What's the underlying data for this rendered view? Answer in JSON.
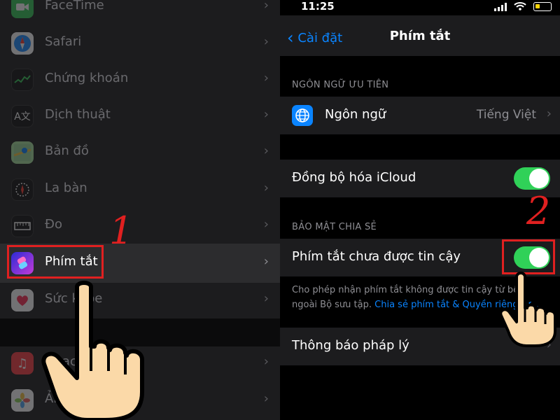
{
  "left_settings": {
    "items": [
      {
        "label": "FaceTime",
        "icon": "facetime-icon",
        "color": "#34c759"
      },
      {
        "label": "Safari",
        "icon": "safari-icon",
        "color": "#0a84ff"
      },
      {
        "label": "Chứng khoán",
        "icon": "stocks-icon",
        "color": "#1c1c1e"
      },
      {
        "label": "Dịch thuật",
        "icon": "translate-icon",
        "color": "#1c1c1e"
      },
      {
        "label": "Bản đồ",
        "icon": "maps-icon",
        "color": "#34c759"
      },
      {
        "label": "La bàn",
        "icon": "compass-icon",
        "color": "#1c1c1e"
      },
      {
        "label": "Đo",
        "icon": "measure-icon",
        "color": "#1c1c1e"
      },
      {
        "label": "Phím tắt",
        "icon": "shortcuts-icon",
        "color": "#5e5ce6"
      },
      {
        "label": "Sức khỏe",
        "icon": "health-icon",
        "color": "#ffffff"
      },
      {
        "label": "Nhạc",
        "icon": "music-icon",
        "color": "#fc3c44"
      },
      {
        "label": "Ảnh",
        "icon": "photos-icon",
        "color": "#ffffff"
      }
    ]
  },
  "annotations": {
    "step1": "1",
    "step2": "2"
  },
  "status_bar": {
    "time": "11:25"
  },
  "navbar": {
    "back_label": "Cài đặt",
    "title": "Phím tắt"
  },
  "preferred_language": {
    "header": "NGÔN NGỮ ƯU TIÊN",
    "label": "Ngôn ngữ",
    "value": "Tiếng Việt"
  },
  "icloud_sync": {
    "label": "Đồng bộ hóa iCloud",
    "enabled": true
  },
  "sharing_security": {
    "header": "BẢO MẬT CHIA SẺ",
    "untrusted_label": "Phím tắt chưa được tin cậy",
    "enabled": true,
    "footer_line1": "Cho phép nhận phím tắt không được tin cậy từ bên",
    "footer_line2_prefix": "ngoài Bộ sưu tập.",
    "footer_link": "Chia sẻ phím tắt & Quyền riêng tư..."
  },
  "legal": {
    "label": "Thông báo pháp lý"
  },
  "colors": {
    "accent": "#0a84ff",
    "toggle_on": "#30d158",
    "annotation_red": "#e02020",
    "hand_fill": "#fbd9a8"
  }
}
